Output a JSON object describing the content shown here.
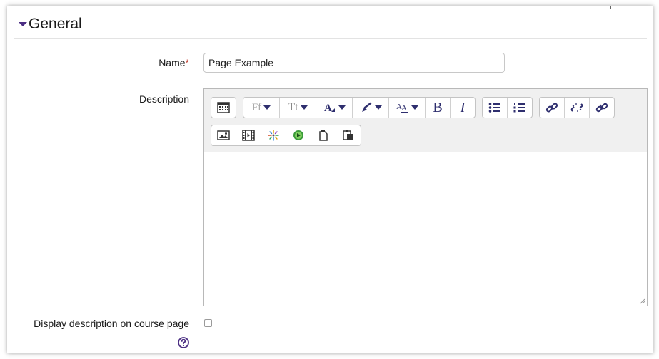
{
  "section": {
    "title": "General"
  },
  "name_field": {
    "label": "Name",
    "required_mark": "*",
    "value": "Page Example"
  },
  "description": {
    "label": "Description"
  },
  "toolbar": {
    "font_family_label": "Ff",
    "font_size_label": "Tt",
    "bold": "B",
    "italic": "I"
  },
  "display_option": {
    "label": "Display description on course page",
    "checked": false
  },
  "colors": {
    "accent": "#4b2e83",
    "toolbar_bg": "#f0f0f0",
    "icon": "#2e2e6e"
  }
}
